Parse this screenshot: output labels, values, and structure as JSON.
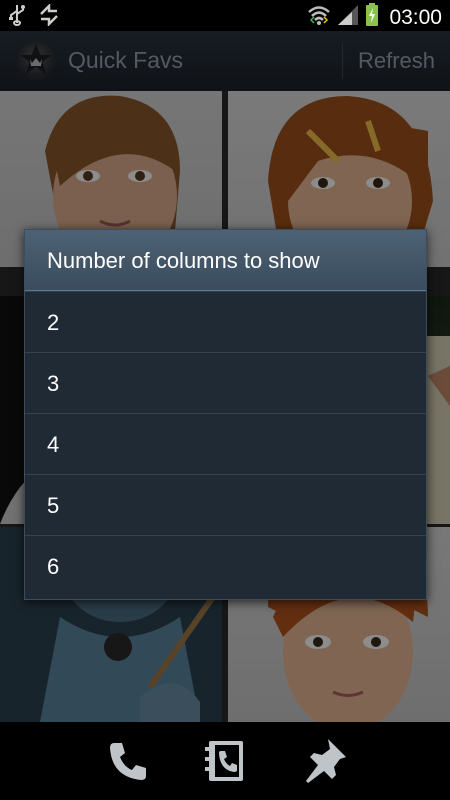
{
  "status_bar": {
    "time": "03:00",
    "icons": [
      "usb-icon",
      "sync-icon",
      "wifi-icon",
      "signal-icon",
      "battery-charging-icon"
    ]
  },
  "action_bar": {
    "title": "Quick Favs",
    "refresh_label": "Refresh",
    "logo_icon": "star-crown-logo"
  },
  "dialog": {
    "title": "Number of columns to show",
    "options": [
      "2",
      "3",
      "4",
      "5",
      "6"
    ]
  },
  "bottom_bar": {
    "icons": [
      "phone-icon",
      "contacts-icon",
      "pin-icon"
    ]
  },
  "colors": {
    "dialog_title_bg": "#435669",
    "dialog_bg": "#1f2a35",
    "action_bar_bg": "#232c35"
  }
}
